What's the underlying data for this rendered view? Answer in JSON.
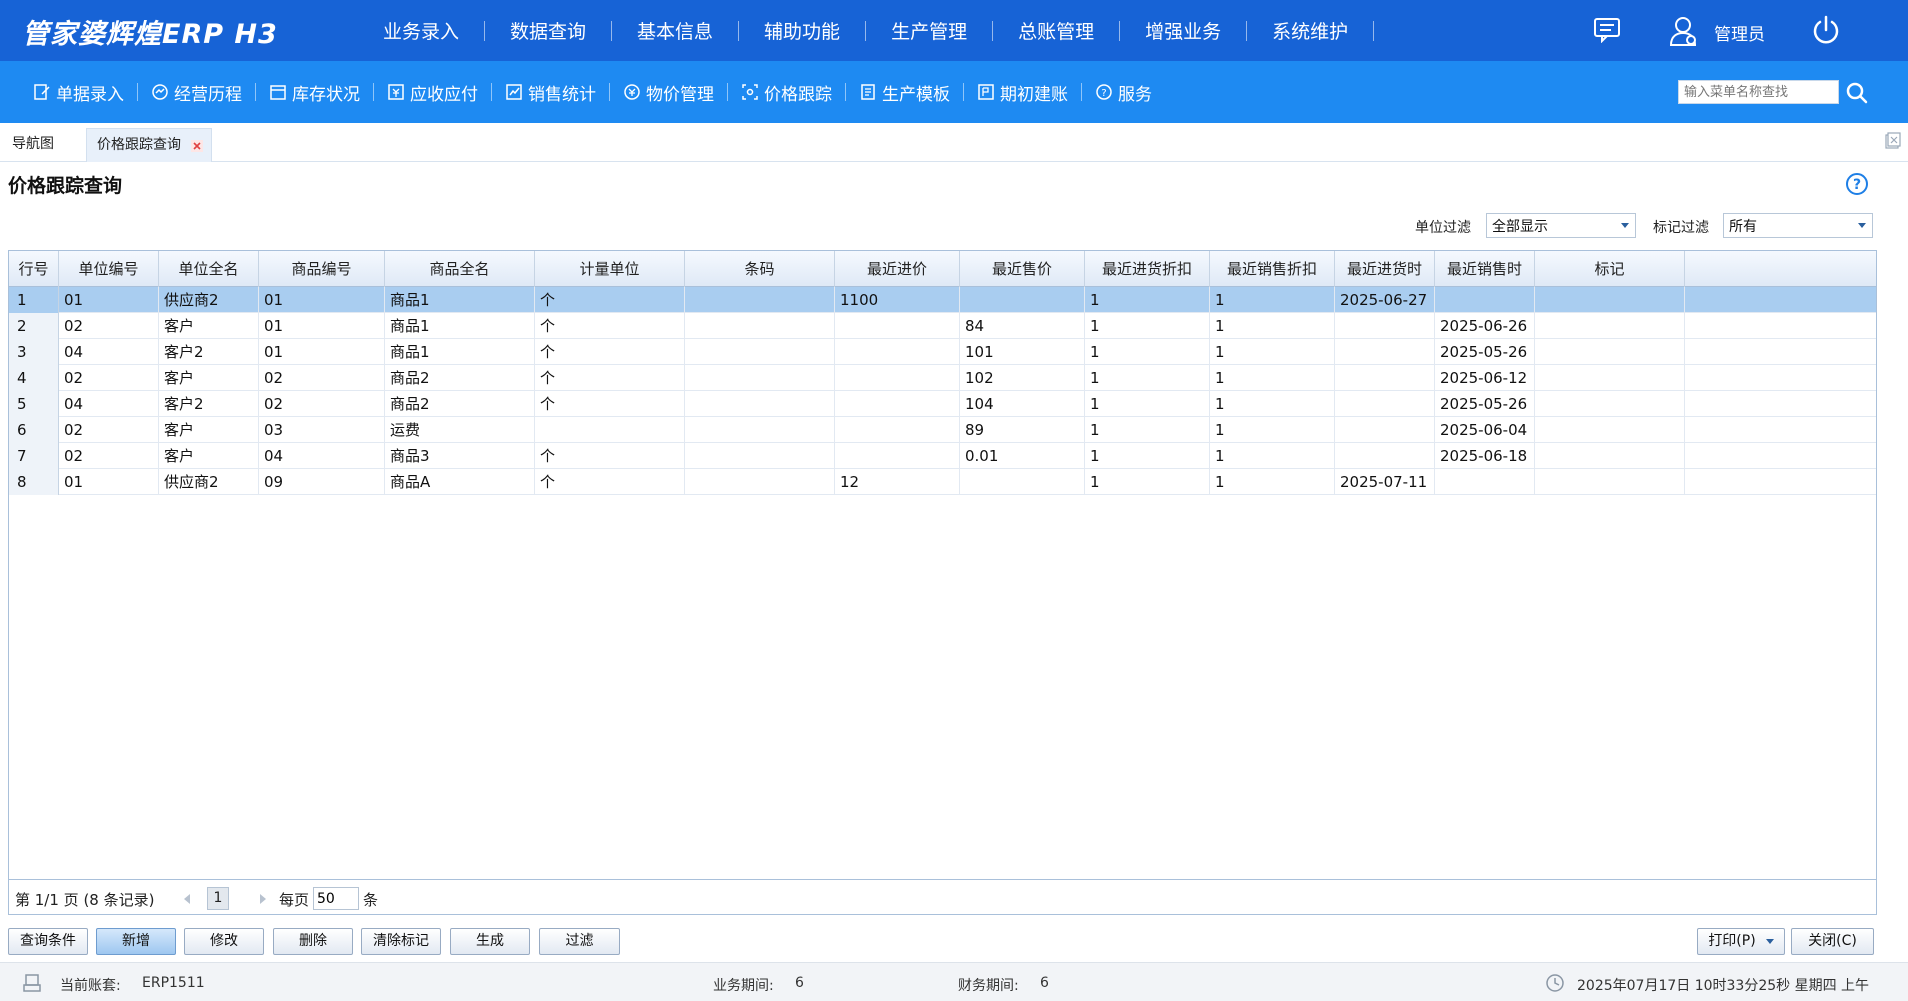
{
  "app": {
    "logo": "管家婆辉煌ERP H3"
  },
  "top_nav": {
    "items": [
      "业务录入",
      "数据查询",
      "基本信息",
      "辅助功能",
      "生产管理",
      "总账管理",
      "增强业务",
      "系统维护"
    ],
    "user_name": "管理员"
  },
  "sub_nav": {
    "items": [
      {
        "label": "单据录入",
        "icon": "edit-doc-icon"
      },
      {
        "label": "经营历程",
        "icon": "history-icon"
      },
      {
        "label": "库存状况",
        "icon": "calendar-icon"
      },
      {
        "label": "应收应付",
        "icon": "money-icon"
      },
      {
        "label": "销售统计",
        "icon": "chart-icon"
      },
      {
        "label": "物价管理",
        "icon": "price-icon"
      },
      {
        "label": "价格跟踪",
        "icon": "track-icon"
      },
      {
        "label": "生产模板",
        "icon": "template-icon"
      },
      {
        "label": "期初建账",
        "icon": "ledger-icon"
      },
      {
        "label": "服务",
        "icon": "help-icon"
      }
    ],
    "search_placeholder": "输入菜单名称查找"
  },
  "tabs": {
    "home": "导航图",
    "active": "价格跟踪查询"
  },
  "page": {
    "title": "价格跟踪查询"
  },
  "filters": {
    "unit_label": "单位过滤",
    "unit_value": "全部显示",
    "mark_label": "标记过滤",
    "mark_value": "所有"
  },
  "table": {
    "columns": [
      "行号",
      "单位编号",
      "单位全名",
      "商品编号",
      "商品全名",
      "计量单位",
      "条码",
      "最近进价",
      "最近售价",
      "最近进货折扣",
      "最近销售折扣",
      "最近进货时",
      "最近销售时",
      "标记"
    ],
    "rows": [
      [
        "1",
        "01",
        "供应商2",
        "01",
        "商品1",
        "个",
        "",
        "1100",
        "",
        "1",
        "1",
        "2025-06-27",
        "",
        ""
      ],
      [
        "2",
        "02",
        "客户",
        "01",
        "商品1",
        "个",
        "",
        "",
        "84",
        "1",
        "1",
        "",
        "2025-06-26",
        ""
      ],
      [
        "3",
        "04",
        "客户2",
        "01",
        "商品1",
        "个",
        "",
        "",
        "101",
        "1",
        "1",
        "",
        "2025-05-26",
        ""
      ],
      [
        "4",
        "02",
        "客户",
        "02",
        "商品2",
        "个",
        "",
        "",
        "102",
        "1",
        "1",
        "",
        "2025-06-12",
        ""
      ],
      [
        "5",
        "04",
        "客户2",
        "02",
        "商品2",
        "个",
        "",
        "",
        "104",
        "1",
        "1",
        "",
        "2025-05-26",
        ""
      ],
      [
        "6",
        "02",
        "客户",
        "03",
        "运费",
        "",
        "",
        "",
        "89",
        "1",
        "1",
        "",
        "2025-06-04",
        ""
      ],
      [
        "7",
        "02",
        "客户",
        "04",
        "商品3",
        "个",
        "",
        "",
        "0.01",
        "1",
        "1",
        "",
        "2025-06-18",
        ""
      ],
      [
        "8",
        "01",
        "供应商2",
        "09",
        "商品A",
        "个",
        "",
        "12",
        "",
        "1",
        "1",
        "2025-07-11",
        "",
        ""
      ]
    ],
    "selected_row": 1
  },
  "pager": {
    "summary": "第 1/1 页 (8 条记录)",
    "current_page": "1",
    "per_page_label": "每页",
    "per_page_value": "50",
    "per_page_unit": "条"
  },
  "buttons": {
    "query": "查询条件",
    "add": "新增",
    "edit": "修改",
    "delete": "删除",
    "clear_mark": "清除标记",
    "generate": "生成",
    "filter": "过滤",
    "print": "打印(P)",
    "close": "关闭(C)"
  },
  "status": {
    "account_label": "当前账套:",
    "account_value": "ERP1511",
    "biz_period_label": "业务期间:",
    "biz_period_value": "6",
    "fin_period_label": "财务期间:",
    "fin_period_value": "6",
    "datetime": "2025年07月17日 10时33分25秒 星期四 上午"
  },
  "colors": {
    "topbar": "#1763d6",
    "subbar": "#1e8af2",
    "selected_row": "#a9cdf0"
  }
}
